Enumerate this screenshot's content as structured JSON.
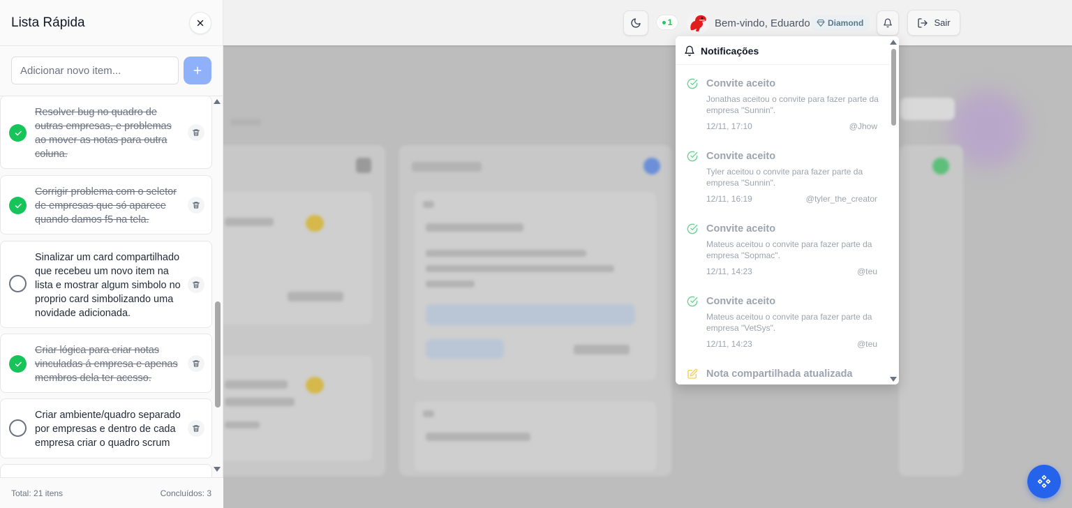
{
  "header": {
    "online_count": "1",
    "welcome": "Bem-vindo, Eduardo",
    "plan_badge": "Diamond",
    "exit_label": "Sair"
  },
  "drawer": {
    "title": "Lista Rápida",
    "input_placeholder": "Adicionar novo item...",
    "items": [
      {
        "text": "Resolver bug no quadro de outras empresas, e problemas ao mover as notas para outra coluna.",
        "done": true
      },
      {
        "text": "Corrigir problema com o seletor de empresas que só aparece quando damos f5 na tela.",
        "done": true
      },
      {
        "text": "Sinalizar um card compartilhado que recebeu um novo item na lista e mostrar algum simbolo no proprio card simbolizando uma novidade adicionada.",
        "done": false
      },
      {
        "text": "Criar lógica para criar notas vinculadas á empresa e apenas membros dela ter acesso.",
        "done": true
      },
      {
        "text": "Criar ambiente/quadro separado por empresas e dentro de cada empresa criar o quadro scrum",
        "done": false
      }
    ],
    "footer_total": "Total: 21 itens",
    "footer_done": "Concluídos: 3"
  },
  "notifications": {
    "title": "Notificações",
    "items": [
      {
        "title": "Convite aceito",
        "body": "Jonathas aceitou o convite para fazer parte da empresa \"Sunnin\".",
        "date": "12/11, 17:10",
        "user": "@Jhow",
        "icon": "check-circle-icon"
      },
      {
        "title": "Convite aceito",
        "body": "Tyler aceitou o convite para fazer parte da empresa \"Sunnin\".",
        "date": "12/11, 16:19",
        "user": "@tyler_the_creator",
        "icon": "check-circle-icon"
      },
      {
        "title": "Convite aceito",
        "body": "Mateus aceitou o convite para fazer parte da empresa \"Sopmac\".",
        "date": "12/11, 14:23",
        "user": "@teu",
        "icon": "check-circle-icon"
      },
      {
        "title": "Convite aceito",
        "body": "Mateus aceitou o convite para fazer parte da empresa \"VetSys\".",
        "date": "12/11, 14:23",
        "user": "@teu",
        "icon": "check-circle-icon"
      },
      {
        "title": "Nota compartilhada atualizada",
        "icon": "edit-note-icon"
      }
    ]
  },
  "colors": {
    "success": "#16c45a",
    "primary": "#2563eb",
    "add_button": "#8fb1f9",
    "note_icon": "#facc15"
  }
}
